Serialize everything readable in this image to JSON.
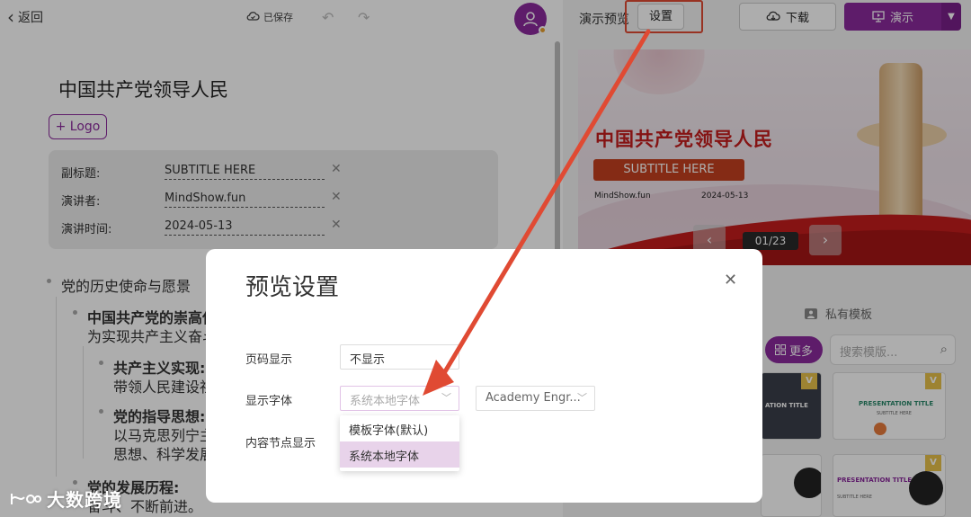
{
  "editor": {
    "back_label": "返回",
    "save_status": "已保存",
    "doc_title": "中国共产党领导人民",
    "logo_button": "+ Logo",
    "meta": [
      {
        "label": "副标题:",
        "value": "SUBTITLE HERE"
      },
      {
        "label": "演讲者:",
        "value": "MindShow.fun"
      },
      {
        "label": "演讲时间:",
        "value": "2024-05-13"
      }
    ],
    "outline": {
      "l1a": "党的历史使命与愿景",
      "l2a_title": "中国共产党的崇高使命",
      "l2a_body": "为实现共产主义奋斗终",
      "l3a_title": "共产主义实现:",
      "l3a_body": "带领人民建设社会",
      "l3b_title": "党的指导思想:",
      "l3b_body1": "以马克思列宁主义",
      "l3b_body2": "思想、科学发展观",
      "l2b_title": "党的发展历程:",
      "l2b_body": "奋斗、不断前进。"
    }
  },
  "preview": {
    "label": "演示预览",
    "settings_button": "设置",
    "download_button": "下载",
    "present_button": "演示",
    "slide": {
      "title": "中国共产党领导人民",
      "subtitle": "SUBTITLE HERE",
      "author": "MindShow.fun",
      "date": "2024-05-13",
      "page": "01/23"
    },
    "private_templates_tab": "私有模板",
    "more_button": "更多",
    "search_placeholder": "搜索模版...",
    "thumb_text_1": "ATION TITLE",
    "thumb_text_2": "PRESENTATION TITLE",
    "thumb_text_2_sub": "SUBTITLE HERE",
    "thumb_text_4": "PRESENTATION TITLE",
    "thumb_text_4_sub": "SUBTITLE HERE",
    "vip_badge": "V"
  },
  "modal": {
    "title": "预览设置",
    "page_number_label": "页码显示",
    "page_number_value": "不显示",
    "font_label": "显示字体",
    "font_value": "系统本地字体",
    "font_secondary_value": "Academy Engr...",
    "content_node_label": "内容节点显示",
    "font_options": [
      "模板字体(默认)",
      "系统本地字体"
    ]
  },
  "watermark": "大数跨境",
  "colors": {
    "brand_purple": "#8b2a9d",
    "annotation_red": "#e04a33",
    "slide_red": "#c41d1d"
  }
}
